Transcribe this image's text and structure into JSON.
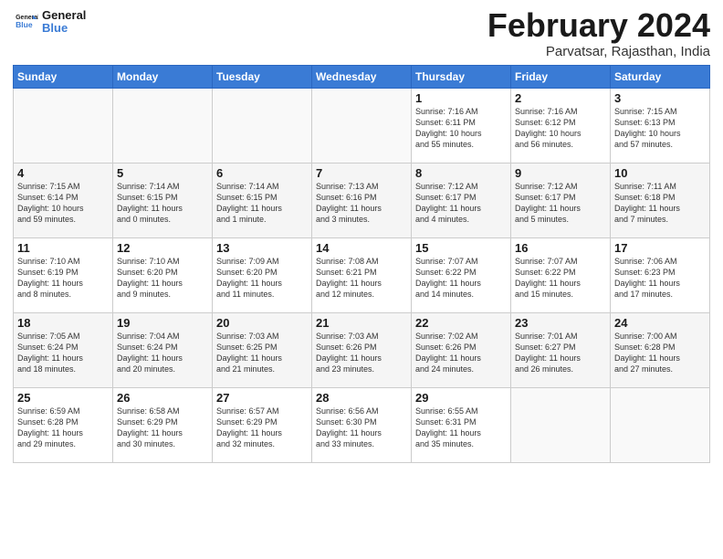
{
  "logo": {
    "text_general": "General",
    "text_blue": "Blue"
  },
  "header": {
    "title": "February 2024",
    "subtitle": "Parvatsar, Rajasthan, India"
  },
  "days_of_week": [
    "Sunday",
    "Monday",
    "Tuesday",
    "Wednesday",
    "Thursday",
    "Friday",
    "Saturday"
  ],
  "weeks": [
    [
      {
        "day": "",
        "info": ""
      },
      {
        "day": "",
        "info": ""
      },
      {
        "day": "",
        "info": ""
      },
      {
        "day": "",
        "info": ""
      },
      {
        "day": "1",
        "info": "Sunrise: 7:16 AM\nSunset: 6:11 PM\nDaylight: 10 hours\nand 55 minutes."
      },
      {
        "day": "2",
        "info": "Sunrise: 7:16 AM\nSunset: 6:12 PM\nDaylight: 10 hours\nand 56 minutes."
      },
      {
        "day": "3",
        "info": "Sunrise: 7:15 AM\nSunset: 6:13 PM\nDaylight: 10 hours\nand 57 minutes."
      }
    ],
    [
      {
        "day": "4",
        "info": "Sunrise: 7:15 AM\nSunset: 6:14 PM\nDaylight: 10 hours\nand 59 minutes."
      },
      {
        "day": "5",
        "info": "Sunrise: 7:14 AM\nSunset: 6:15 PM\nDaylight: 11 hours\nand 0 minutes."
      },
      {
        "day": "6",
        "info": "Sunrise: 7:14 AM\nSunset: 6:15 PM\nDaylight: 11 hours\nand 1 minute."
      },
      {
        "day": "7",
        "info": "Sunrise: 7:13 AM\nSunset: 6:16 PM\nDaylight: 11 hours\nand 3 minutes."
      },
      {
        "day": "8",
        "info": "Sunrise: 7:12 AM\nSunset: 6:17 PM\nDaylight: 11 hours\nand 4 minutes."
      },
      {
        "day": "9",
        "info": "Sunrise: 7:12 AM\nSunset: 6:17 PM\nDaylight: 11 hours\nand 5 minutes."
      },
      {
        "day": "10",
        "info": "Sunrise: 7:11 AM\nSunset: 6:18 PM\nDaylight: 11 hours\nand 7 minutes."
      }
    ],
    [
      {
        "day": "11",
        "info": "Sunrise: 7:10 AM\nSunset: 6:19 PM\nDaylight: 11 hours\nand 8 minutes."
      },
      {
        "day": "12",
        "info": "Sunrise: 7:10 AM\nSunset: 6:20 PM\nDaylight: 11 hours\nand 9 minutes."
      },
      {
        "day": "13",
        "info": "Sunrise: 7:09 AM\nSunset: 6:20 PM\nDaylight: 11 hours\nand 11 minutes."
      },
      {
        "day": "14",
        "info": "Sunrise: 7:08 AM\nSunset: 6:21 PM\nDaylight: 11 hours\nand 12 minutes."
      },
      {
        "day": "15",
        "info": "Sunrise: 7:07 AM\nSunset: 6:22 PM\nDaylight: 11 hours\nand 14 minutes."
      },
      {
        "day": "16",
        "info": "Sunrise: 7:07 AM\nSunset: 6:22 PM\nDaylight: 11 hours\nand 15 minutes."
      },
      {
        "day": "17",
        "info": "Sunrise: 7:06 AM\nSunset: 6:23 PM\nDaylight: 11 hours\nand 17 minutes."
      }
    ],
    [
      {
        "day": "18",
        "info": "Sunrise: 7:05 AM\nSunset: 6:24 PM\nDaylight: 11 hours\nand 18 minutes."
      },
      {
        "day": "19",
        "info": "Sunrise: 7:04 AM\nSunset: 6:24 PM\nDaylight: 11 hours\nand 20 minutes."
      },
      {
        "day": "20",
        "info": "Sunrise: 7:03 AM\nSunset: 6:25 PM\nDaylight: 11 hours\nand 21 minutes."
      },
      {
        "day": "21",
        "info": "Sunrise: 7:03 AM\nSunset: 6:26 PM\nDaylight: 11 hours\nand 23 minutes."
      },
      {
        "day": "22",
        "info": "Sunrise: 7:02 AM\nSunset: 6:26 PM\nDaylight: 11 hours\nand 24 minutes."
      },
      {
        "day": "23",
        "info": "Sunrise: 7:01 AM\nSunset: 6:27 PM\nDaylight: 11 hours\nand 26 minutes."
      },
      {
        "day": "24",
        "info": "Sunrise: 7:00 AM\nSunset: 6:28 PM\nDaylight: 11 hours\nand 27 minutes."
      }
    ],
    [
      {
        "day": "25",
        "info": "Sunrise: 6:59 AM\nSunset: 6:28 PM\nDaylight: 11 hours\nand 29 minutes."
      },
      {
        "day": "26",
        "info": "Sunrise: 6:58 AM\nSunset: 6:29 PM\nDaylight: 11 hours\nand 30 minutes."
      },
      {
        "day": "27",
        "info": "Sunrise: 6:57 AM\nSunset: 6:29 PM\nDaylight: 11 hours\nand 32 minutes."
      },
      {
        "day": "28",
        "info": "Sunrise: 6:56 AM\nSunset: 6:30 PM\nDaylight: 11 hours\nand 33 minutes."
      },
      {
        "day": "29",
        "info": "Sunrise: 6:55 AM\nSunset: 6:31 PM\nDaylight: 11 hours\nand 35 minutes."
      },
      {
        "day": "",
        "info": ""
      },
      {
        "day": "",
        "info": ""
      }
    ]
  ]
}
